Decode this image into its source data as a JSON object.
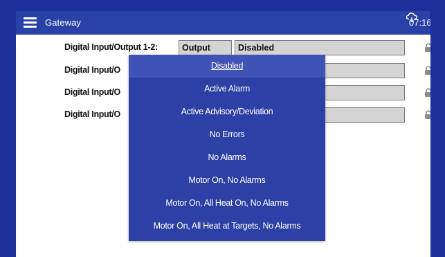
{
  "app": {
    "title": "Gateway",
    "time": "07:16"
  },
  "rows": [
    {
      "label": "Digital Input/Output 1-2:",
      "mode": "Output",
      "value": "Disabled"
    },
    {
      "label": "Digital Input/O",
      "mode": "",
      "value": ""
    },
    {
      "label": "Digital Input/O",
      "mode": "",
      "value": ""
    },
    {
      "label": "Digital Input/O",
      "mode": "",
      "value": ""
    }
  ],
  "dropdown": {
    "selected": "Disabled",
    "options": [
      "Disabled",
      "Active Alarm",
      "Active Advisory/Deviation",
      "No Errors",
      "No Alarms",
      "Motor On, No Alarms",
      "Motor On, All Heat On, No Alarms",
      "Motor On, All Heat at Targets, No Alarms"
    ]
  },
  "icons": {
    "menu": "hamburger-menu-icon",
    "connection": "cloud-sync-icon",
    "lock": "unlocked-padlock-icon"
  },
  "colors": {
    "background": "#1c2f9b",
    "titlebar": "#2a42a8",
    "dropdown": "#2c40a6",
    "dropdown_selected": "#3f52b6",
    "field": "#d4d4d4"
  }
}
